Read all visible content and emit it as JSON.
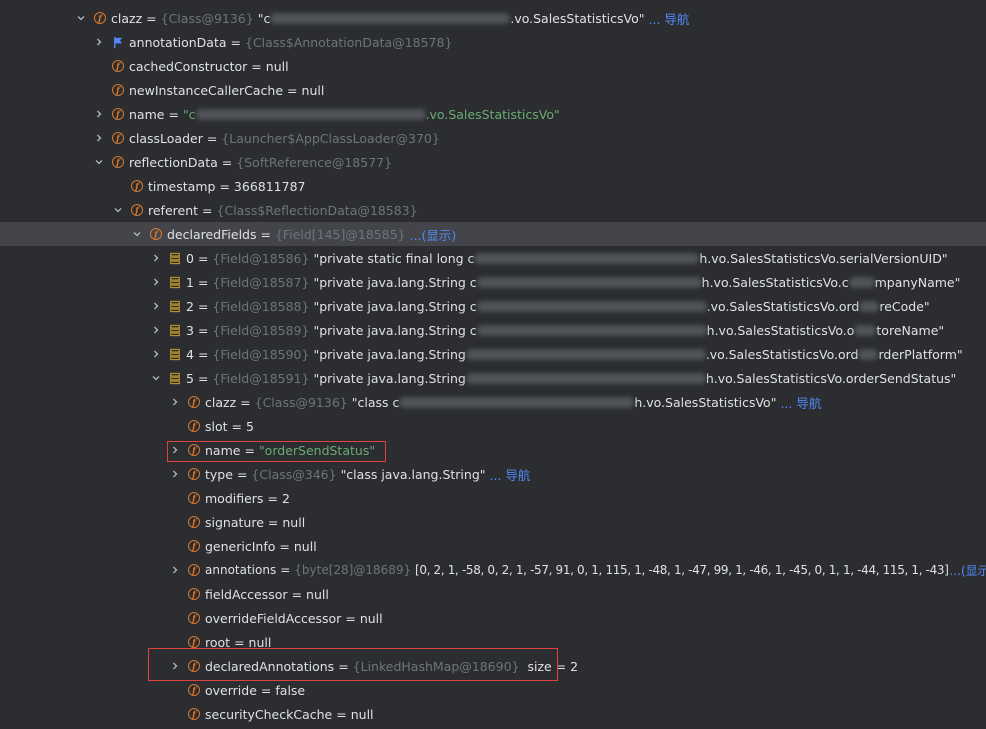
{
  "rows": {
    "clazz": {
      "name": "clazz",
      "type": "{Class@9136}",
      "value": "\"c",
      "value2": ".vo.SalesStatisticsVo\"",
      "link": "... 导航"
    },
    "annotationData": {
      "name": "annotationData",
      "type": "{Class$AnnotationData@18578}"
    },
    "cachedConstructor": {
      "name": "cachedConstructor",
      "value": "null"
    },
    "newInstanceCallerCache": {
      "name": "newInstanceCallerCache",
      "value": "null"
    },
    "name": {
      "name": "name",
      "value": "\"c",
      "value2": ".vo.SalesStatisticsVo\""
    },
    "classLoader": {
      "name": "classLoader",
      "type": "{Launcher$AppClassLoader@370}"
    },
    "reflectionData": {
      "name": "reflectionData",
      "type": "{SoftReference@18577}"
    },
    "timestamp": {
      "name": "timestamp",
      "value": "366811787"
    },
    "referent": {
      "name": "referent",
      "type": "{Class$ReflectionData@18583}"
    },
    "declaredFields": {
      "name": "declaredFields",
      "type": "{Field[145]@18585}",
      "link": "...(显示)"
    },
    "f0": {
      "name": "0",
      "type": "{Field@18586}",
      "value": "\"private static final long c",
      "value2": "h.vo.SalesStatisticsVo.serialVersionUID\""
    },
    "f1": {
      "name": "1",
      "type": "{Field@18587}",
      "value": "\"private java.lang.String c",
      "value2": "h.vo.SalesStatisticsVo.c",
      "value3": "mpanyName\""
    },
    "f2": {
      "name": "2",
      "type": "{Field@18588}",
      "value": "\"private java.lang.String c",
      "value2": ".vo.SalesStatisticsVo.ord",
      "value3": "reCode\""
    },
    "f3": {
      "name": "3",
      "type": "{Field@18589}",
      "value": "\"private java.lang.String c",
      "value2": "h.vo.SalesStatisticsVo.o",
      "value3": "toreName\""
    },
    "f4": {
      "name": "4",
      "type": "{Field@18590}",
      "value": "\"private java.lang.String",
      "value2": ".vo.SalesStatisticsVo.ord",
      "value3": "rderPlatform\""
    },
    "f5": {
      "name": "5",
      "type": "{Field@18591}",
      "value": "\"private java.lang.String",
      "value2": "h.vo.SalesStatisticsVo.orderSendStatus\""
    },
    "f5clazz": {
      "name": "clazz",
      "type": "{Class@9136}",
      "value": "\"class c",
      "value2": "h.vo.SalesStatisticsVo\"",
      "link": "... 导航"
    },
    "slot": {
      "name": "slot",
      "value": "5"
    },
    "f5name": {
      "name": "name",
      "value": "\"orderSendStatus\""
    },
    "type": {
      "name": "type",
      "type": "{Class@346}",
      "value": "\"class java.lang.String\"",
      "link": "... 导航"
    },
    "modifiers": {
      "name": "modifiers",
      "value": "2"
    },
    "signature": {
      "name": "signature",
      "value": "null"
    },
    "genericInfo": {
      "name": "genericInfo",
      "value": "null"
    },
    "annotations": {
      "name": "annotations",
      "type": "{byte[28]@18689}",
      "value": "[0, 2, 1, -58, 0, 2, 1, -57, 91, 0, 1, 115, 1, -48, 1, -47, 99, 1, -46, 1, -45, 0, 1, 1, -44, 115, 1, -43]",
      "link": "...(显示)"
    },
    "fieldAccessor": {
      "name": "fieldAccessor",
      "value": "null"
    },
    "overrideFieldAccessor": {
      "name": "overrideFieldAccessor",
      "value": "null"
    },
    "root": {
      "name": "root",
      "value": "null"
    },
    "declaredAnnotations": {
      "name": "declaredAnnotations",
      "type": "{LinkedHashMap@18690}",
      "value": "size = 2"
    },
    "override": {
      "name": "override",
      "value": "false"
    },
    "securityCheckCache": {
      "name": "securityCheckCache",
      "value": "null"
    }
  },
  "colors": {
    "field_icon": "#d9772b",
    "string": "#6aab73",
    "type": "#6f737a",
    "link": "#548af7",
    "highlight_box": "#e0413c",
    "selected_row": "#43454a"
  }
}
